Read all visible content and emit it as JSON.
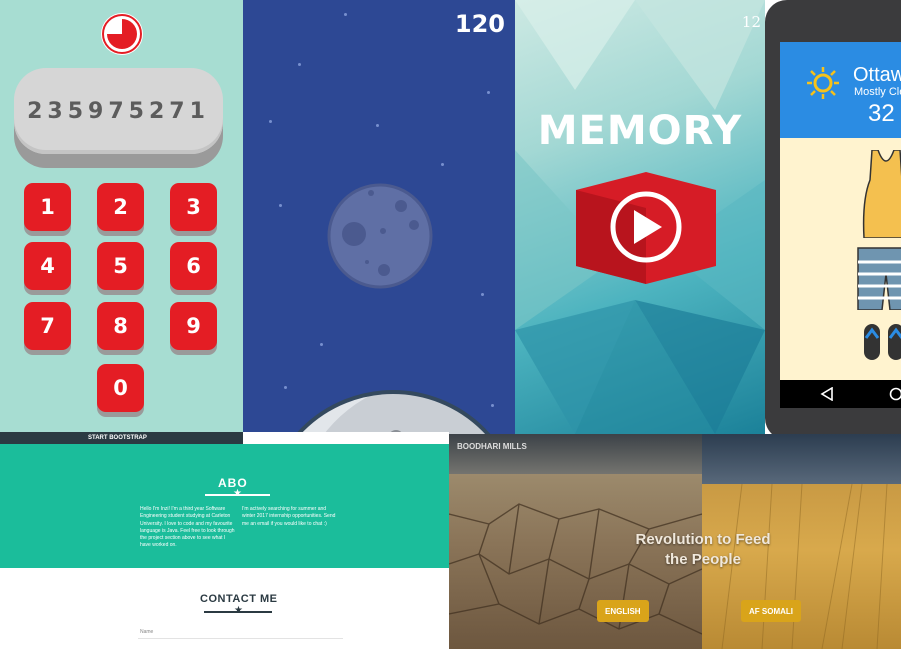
{
  "keypad": {
    "display_value": "235975271",
    "keys": [
      "1",
      "2",
      "3",
      "4",
      "5",
      "6",
      "7",
      "8",
      "9",
      "0"
    ],
    "colors": {
      "background": "#a7ddd2",
      "key": "#e41d24"
    }
  },
  "space_game": {
    "score": "120"
  },
  "memory_game": {
    "title": "MEMORY",
    "corner_number": "12"
  },
  "weather_app": {
    "city": "Ottaw",
    "condition": "Mostly Cle",
    "temperature": "32"
  },
  "website": {
    "nav_label": "START BOOTSTRAP",
    "about": {
      "title": "ABO",
      "text_left": "Hello I'm Inzi! I'm a third year Software Engineering student studying at Carleton University. I love to code and my favourite language is Java. Feel free to look through the project section above to see what I have worked on.",
      "text_right": "I'm actively searching for summer and winter 2017 internship opportunities. Send me an email if you would like to chat :)"
    },
    "contact": {
      "title": "CONTACT ME",
      "name_placeholder": "Name"
    }
  },
  "boodhari": {
    "brand": "BOODHARI MILLS",
    "tagline_line1": "Revolution to Feed",
    "tagline_line2": "the People",
    "buttons": [
      "ENGLISH",
      "AF SOMALI"
    ]
  }
}
